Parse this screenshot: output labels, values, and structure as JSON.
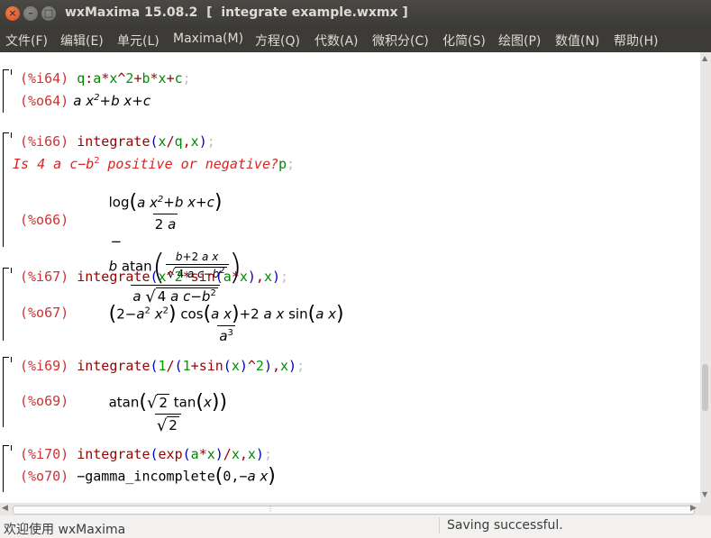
{
  "window": {
    "title": "wxMaxima 15.08.2  [  integrate example.wxmx ]"
  },
  "menu": {
    "items": [
      "文件(F)",
      "编辑(E)",
      "单元(L)",
      "Maxima(M)",
      "方程(Q)",
      "代数(A)",
      "微积分(C)",
      "化简(S)",
      "绘图(P)",
      "数值(N)",
      "帮助(H)"
    ]
  },
  "cells": {
    "c64": {
      "in_label": "(%i64)",
      "out_label": "(%o64)"
    },
    "c66": {
      "in_label": "(%i66)",
      "out_label": "(%o66)",
      "question": "Is 4 a c−b",
      "question_tail": " positive or negative?",
      "answer": "p"
    },
    "c67": {
      "in_label": "(%i67)",
      "out_label": "(%o67)"
    },
    "c69": {
      "in_label": "(%i69)",
      "out_label": "(%o69)"
    },
    "c70": {
      "in_label": "(%i70)",
      "out_label": "(%o70)",
      "out_text": "−gamma_incomplete"
    }
  },
  "status": {
    "left": "欢迎使用 wxMaxima",
    "right": "Saving successful."
  },
  "colors": {
    "label_red": "#cc3333",
    "keyword_dark_red": "#990000",
    "variable_green": "#008800",
    "paren_blue": "#0000bb",
    "menubar": "#3c3b37"
  }
}
